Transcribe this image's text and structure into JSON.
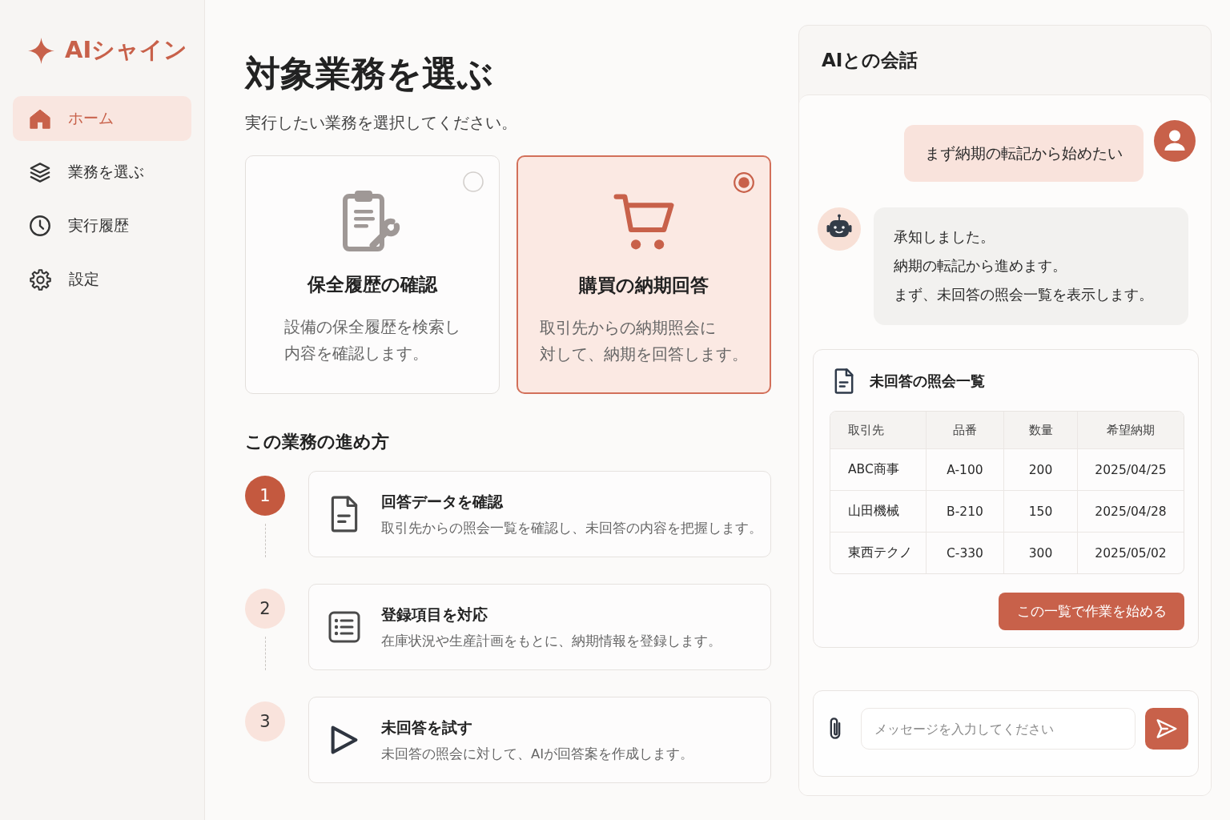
{
  "sidebar": {
    "logo": "AIシャイン",
    "items": [
      {
        "label": "ホーム",
        "kind": "home",
        "selected": true
      },
      {
        "label": "業務を選ぶ",
        "kind": "layers",
        "selected": false
      },
      {
        "label": "実行履歴",
        "kind": "clock",
        "selected": false
      },
      {
        "label": "設定",
        "kind": "gear",
        "selected": false
      }
    ]
  },
  "page": {
    "title": "対象業務を選ぶ",
    "subtitle": "実行したい業務を選択してください。"
  },
  "task_cards": [
    {
      "kind": "maintenance",
      "title": "保全履歴の確認",
      "description_lines": [
        "設備の保全履歴を検索し",
        "内容を確認します。"
      ],
      "selected": false
    },
    {
      "kind": "purchase",
      "title": "購買の納期回答",
      "description_lines": [
        "取引先からの納期照会に",
        "対して、納期を回答します。"
      ],
      "selected": true
    }
  ],
  "process": {
    "heading": "この業務の進め方",
    "steps": [
      {
        "number": "1",
        "kind": "document",
        "title": "回答データを確認",
        "description": "取引先からの照会一覧を確認し、未回答の内容を把握します。",
        "current": true
      },
      {
        "number": "2",
        "kind": "list",
        "title": "登録項目を対応",
        "description": "在庫状況や生産計画をもとに、納期情報を登録します。",
        "current": false
      },
      {
        "number": "3",
        "kind": "play",
        "title": "未回答を試す",
        "description": "未回答の照会に対して、AIが回答案を作成します。",
        "current": false
      }
    ]
  },
  "chat": {
    "title": "AIとの会話",
    "messages": [
      {
        "kind": "user",
        "lines": [
          "まず納期の転記から始めたい"
        ]
      },
      {
        "kind": "bot",
        "lines": [
          "承知しました。",
          "納期の転記から進めます。",
          "まず、未回答の照会一覧を表示します。"
        ]
      }
    ],
    "inquiry_list": {
      "title": "未回答の照会一覧",
      "columns": [
        "取引先",
        "品番",
        "数量",
        "希望納期"
      ],
      "rows": [
        [
          "ABC商事",
          "A-100",
          "200",
          "2025/04/25"
        ],
        [
          "山田機械",
          "B-210",
          "150",
          "2025/04/28"
        ],
        [
          "東西テクノ",
          "C-330",
          "300",
          "2025/05/02"
        ]
      ],
      "button": "この一覧で作業を始める"
    },
    "composer": {
      "placeholder": "メッセージを入力してください"
    }
  }
}
